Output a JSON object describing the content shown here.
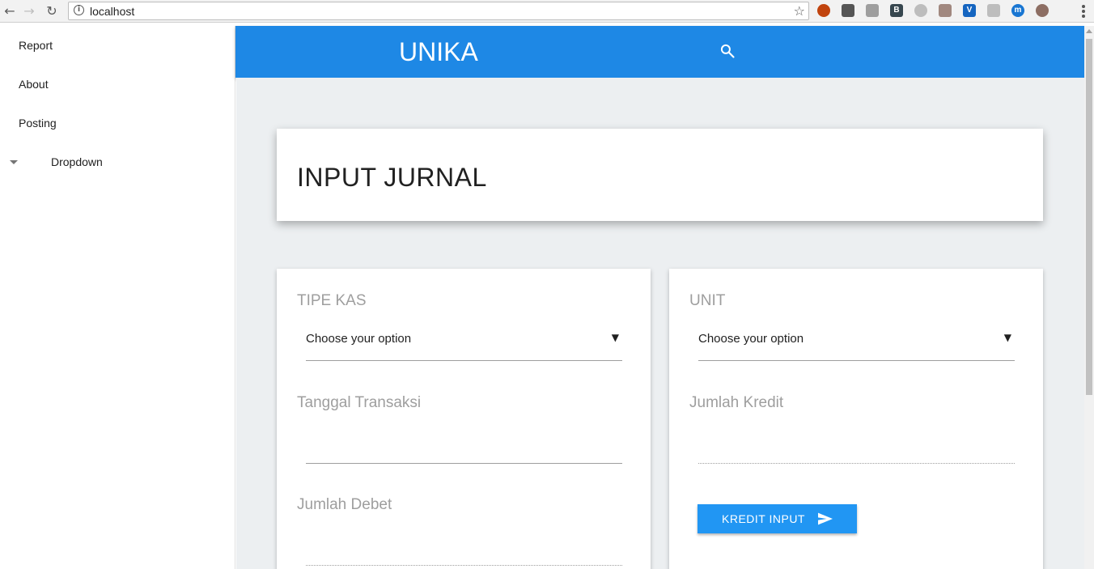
{
  "browser": {
    "url": "localhost",
    "back_icon": "←",
    "forward_icon": "→",
    "reload_icon": "↻",
    "star_icon": "☆",
    "info_icon": "i",
    "extensions": [
      {
        "name": "ublock-icon",
        "letter": "",
        "color": "#c1440e"
      },
      {
        "name": "qr-icon",
        "letter": "",
        "color": "#555555"
      },
      {
        "name": "cube-icon",
        "letter": "",
        "color": "#9e9e9e"
      },
      {
        "name": "b-icon",
        "letter": "B",
        "color": "#37474f"
      },
      {
        "name": "circle-icon",
        "letter": "",
        "color": "#bdbdbd"
      },
      {
        "name": "note-icon",
        "letter": "",
        "color": "#a1887f"
      },
      {
        "name": "v-icon",
        "letter": "V",
        "color": "#1565c0"
      },
      {
        "name": "diamond-icon",
        "letter": "",
        "color": "#bdbdbd"
      },
      {
        "name": "m-icon",
        "letter": "m",
        "color": "#1976d2"
      },
      {
        "name": "cookie-icon",
        "letter": "",
        "color": "#8d6e63"
      }
    ]
  },
  "sidebar": {
    "items": [
      {
        "label": "Report"
      },
      {
        "label": "About"
      },
      {
        "label": "Posting"
      },
      {
        "label": "Dropdown"
      }
    ]
  },
  "header": {
    "brand": "UNIKA",
    "color": "#1e88e5"
  },
  "page": {
    "title": "INPUT JURNAL"
  },
  "form_left": {
    "tipe_kas_label": "TIPE KAS",
    "tipe_kas_value": "Choose your option",
    "tanggal_label": "Tanggal Transaksi",
    "debet_label": "Jumlah Debet"
  },
  "form_right": {
    "unit_label": "UNIT",
    "unit_value": "Choose your option",
    "kredit_label": "Jumlah Kredit",
    "button_label": "KREDIT INPUT"
  },
  "select_caret": "▼"
}
